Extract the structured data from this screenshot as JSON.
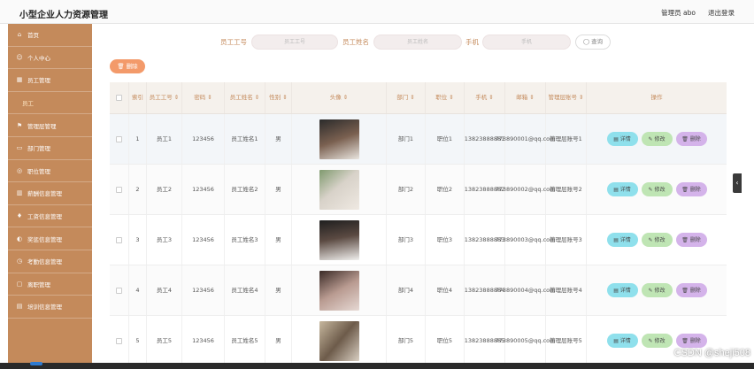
{
  "header": {
    "title": "小型企业人力资源管理",
    "admin": "管理员 abo",
    "logout": "退出登录"
  },
  "sidebar": {
    "items": [
      {
        "icon": "home-icon",
        "glyph": "⌂",
        "label": "首页"
      },
      {
        "icon": "user-icon",
        "glyph": "☺",
        "label": "个人中心"
      },
      {
        "icon": "grid-icon",
        "glyph": "▦",
        "label": "员工管理"
      },
      {
        "icon": "",
        "glyph": "",
        "label": "员工",
        "sub": true
      },
      {
        "icon": "flag-icon",
        "glyph": "⚑",
        "label": "管理层管理"
      },
      {
        "icon": "folder-icon",
        "glyph": "▭",
        "label": "部门管理"
      },
      {
        "icon": "circle-icon",
        "glyph": "◎",
        "label": "职位管理"
      },
      {
        "icon": "building-icon",
        "glyph": "▥",
        "label": "薪酬信息管理"
      },
      {
        "icon": "pin-icon",
        "glyph": "♦",
        "label": "工资信息管理"
      },
      {
        "icon": "chart-icon",
        "glyph": "◐",
        "label": "奖惩信息管理"
      },
      {
        "icon": "clock-icon",
        "glyph": "◷",
        "label": "考勤信息管理"
      },
      {
        "icon": "box-icon",
        "glyph": "▢",
        "label": "离职管理"
      },
      {
        "icon": "book-icon",
        "glyph": "▤",
        "label": "培训信息管理"
      }
    ]
  },
  "search": {
    "label_no": "员工工号",
    "ph_no": "员工工号",
    "label_name": "员工姓名",
    "ph_name": "员工姓名",
    "label_phone": "手机",
    "ph_phone": "手机",
    "btn": "◯ 查询"
  },
  "delete_btn": "🗑 删除",
  "table": {
    "headers": [
      "索引",
      "员工工号 ⇕",
      "密码 ⇕",
      "员工姓名 ⇕",
      "性别 ⇕",
      "头像 ⇕",
      "部门 ⇕",
      "职位 ⇕",
      "手机 ⇕",
      "邮箱 ⇕",
      "管理层账号 ⇕",
      "操作"
    ],
    "ops": {
      "detail": "▤ 详情",
      "edit": "✎ 修改",
      "del": "🗑 删除"
    },
    "rows": [
      {
        "idx": "1",
        "no": "员工1",
        "pwd": "123456",
        "name": "员工姓名1",
        "sex": "男",
        "dept": "部门1",
        "pos": "职位1",
        "phone": "13823888881",
        "email": "773890001@qq.com",
        "mgr": "管理层账号1"
      },
      {
        "idx": "2",
        "no": "员工2",
        "pwd": "123456",
        "name": "员工姓名2",
        "sex": "男",
        "dept": "部门2",
        "pos": "职位2",
        "phone": "13823888882",
        "email": "773890002@qq.com",
        "mgr": "管理层账号2"
      },
      {
        "idx": "3",
        "no": "员工3",
        "pwd": "123456",
        "name": "员工姓名3",
        "sex": "男",
        "dept": "部门3",
        "pos": "职位3",
        "phone": "13823888883",
        "email": "773890003@qq.com",
        "mgr": "管理层账号3"
      },
      {
        "idx": "4",
        "no": "员工4",
        "pwd": "123456",
        "name": "员工姓名4",
        "sex": "男",
        "dept": "部门4",
        "pos": "职位4",
        "phone": "13823888884",
        "email": "773890004@qq.com",
        "mgr": "管理层账号4"
      },
      {
        "idx": "5",
        "no": "员工5",
        "pwd": "123456",
        "name": "员工姓名5",
        "sex": "男",
        "dept": "部门5",
        "pos": "职位5",
        "phone": "13823888885",
        "email": "773890005@qq.com",
        "mgr": "管理层账号5"
      }
    ]
  },
  "side_tab": "‹",
  "watermark": "CSDN @sheji508",
  "colors": {
    "accent": "#c48a5b",
    "orange": "#f39a6a",
    "detail": "#8fe0ec",
    "edit": "#bfe5b4",
    "del": "#d4b3ea"
  }
}
